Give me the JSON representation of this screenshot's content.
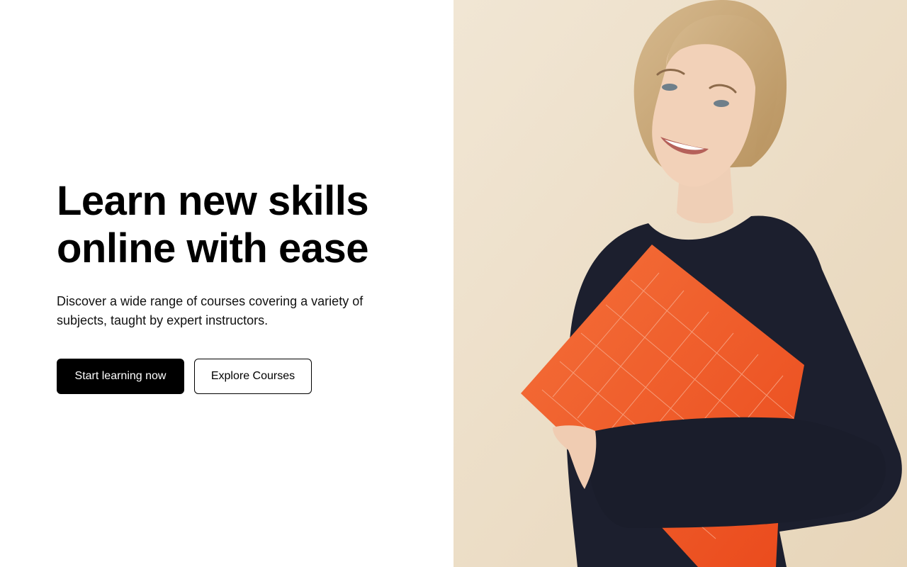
{
  "hero": {
    "title_line1": "Learn new skills",
    "title_line2": "online with ease",
    "subtitle": "Discover a wide range of courses covering a variety of subjects, taught by expert instructors.",
    "primary_button": "Start learning now",
    "secondary_button": "Explore Courses"
  },
  "colors": {
    "primary_button_bg": "#000000",
    "image_background": "#efe2cd",
    "book_accent": "#f05a24"
  }
}
